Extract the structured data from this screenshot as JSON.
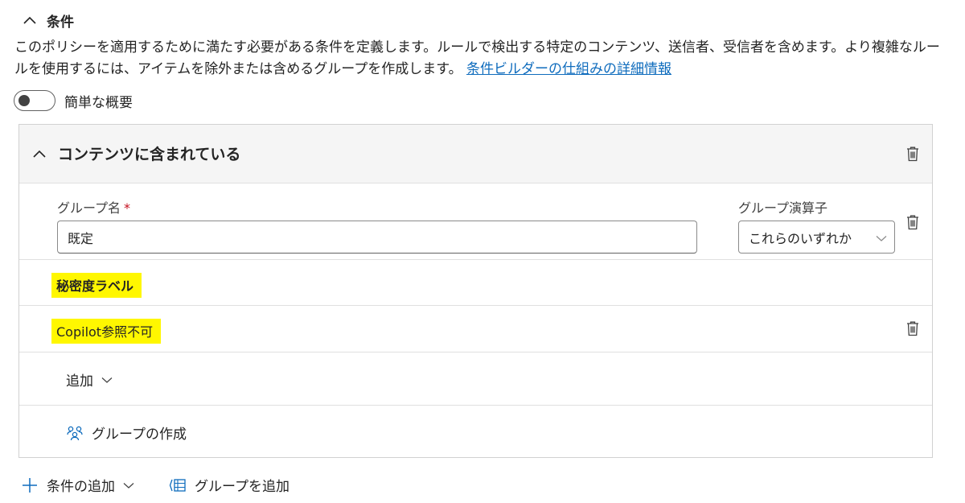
{
  "section": {
    "title": "条件",
    "description": "このポリシーを適用するために満たす必要がある条件を定義します。ルールで検出する特定のコンテンツ、送信者、受信者を含めます。より複雑なルールを使用するには、アイテムを除外または含めるグループを作成します。",
    "learn_more_link": "条件ビルダーの仕組みの詳細情報"
  },
  "toggle": {
    "label": "簡単な概要",
    "checked": false
  },
  "condition_card": {
    "title": "コンテンツに含まれている",
    "group_name_label": "グループ名",
    "required_marker": "*",
    "group_name_value": "既定",
    "group_operator_label": "グループ演算子",
    "group_operator_value": "これらのいずれか",
    "sensitivity_label_heading": "秘密度ラベル",
    "sensitivity_label_item": "Copilot参照不可",
    "add_label": "追加",
    "create_group_label": "グループの作成"
  },
  "actions": {
    "add_condition": "条件の追加",
    "add_group": "グループを追加"
  },
  "colors": {
    "link": "#0f6cbd",
    "highlight": "#fff700",
    "card_header_bg": "#f5f5f5",
    "required": "#c50f1f",
    "accent_icon": "#0f6cbd"
  }
}
